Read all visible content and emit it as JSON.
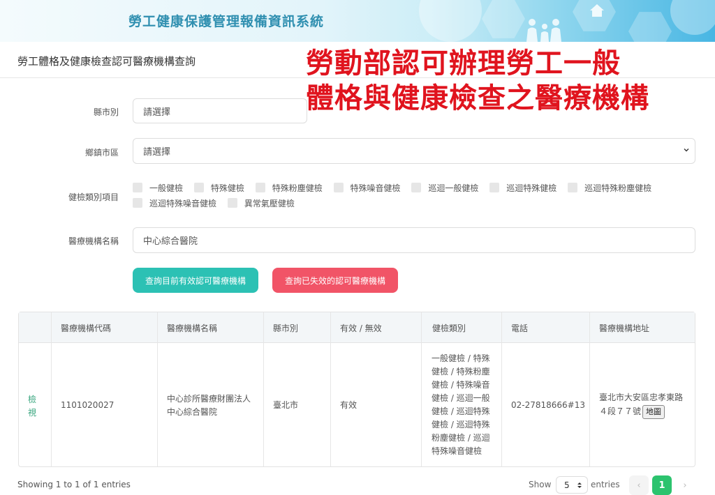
{
  "header": {
    "system_title": "勞工健康保護管理報備資訊系統"
  },
  "page": {
    "title": "勞工體格及健康檢查認可醫療機構查詢"
  },
  "overlay": {
    "line1": "勞動部認可辦理勞工一般",
    "line2": "體格與健康檢查之醫療機構"
  },
  "form": {
    "county_label": "縣市別",
    "county_value": "請選擇",
    "district_label": "鄉鎮市區",
    "district_value": "請選擇",
    "exam_type_label": "健檢類別項目",
    "exam_types": [
      "一般健檢",
      "特殊健檢",
      "特殊粉塵健檢",
      "特殊噪音健檢",
      "巡迴一般健檢",
      "巡迴特殊健檢",
      "巡迴特殊粉塵健檢",
      "巡迴特殊噪音健檢",
      "異常氣壓健檢"
    ],
    "institution_label": "醫療機構名稱",
    "institution_value": "中心綜合醫院",
    "search_valid_label": "查詢目前有效認可醫療機構",
    "search_invalid_label": "查詢已失效的認可醫療機構"
  },
  "table": {
    "headers": [
      "醫療機構代碼",
      "醫療機構名稱",
      "縣市別",
      "有效 / 無效",
      "健檢類別",
      "電話",
      "醫療機構地址"
    ],
    "rows": [
      {
        "action": "檢視",
        "code": "1101020027",
        "name": "中心診所醫療財團法人中心綜合醫院",
        "county": "臺北市",
        "status": "有效",
        "exam_types": "一般健檢 / 特殊健檢 / 特殊粉塵健檢 / 特殊噪音健檢 / 巡迴一般健檢 / 巡迴特殊健檢 / 巡迴特殊粉塵健檢 / 巡迴特殊噪音健檢",
        "phone": "02-27818666#13",
        "address": "臺北市大安區忠孝東路４段７７號",
        "map_label": "地圖"
      }
    ]
  },
  "footer": {
    "summary": "Showing 1 to 1 of 1 entries",
    "show_label": "Show",
    "page_size": "5",
    "entries_label": "entries",
    "prev": "‹",
    "current_page": "1",
    "next": "›"
  }
}
